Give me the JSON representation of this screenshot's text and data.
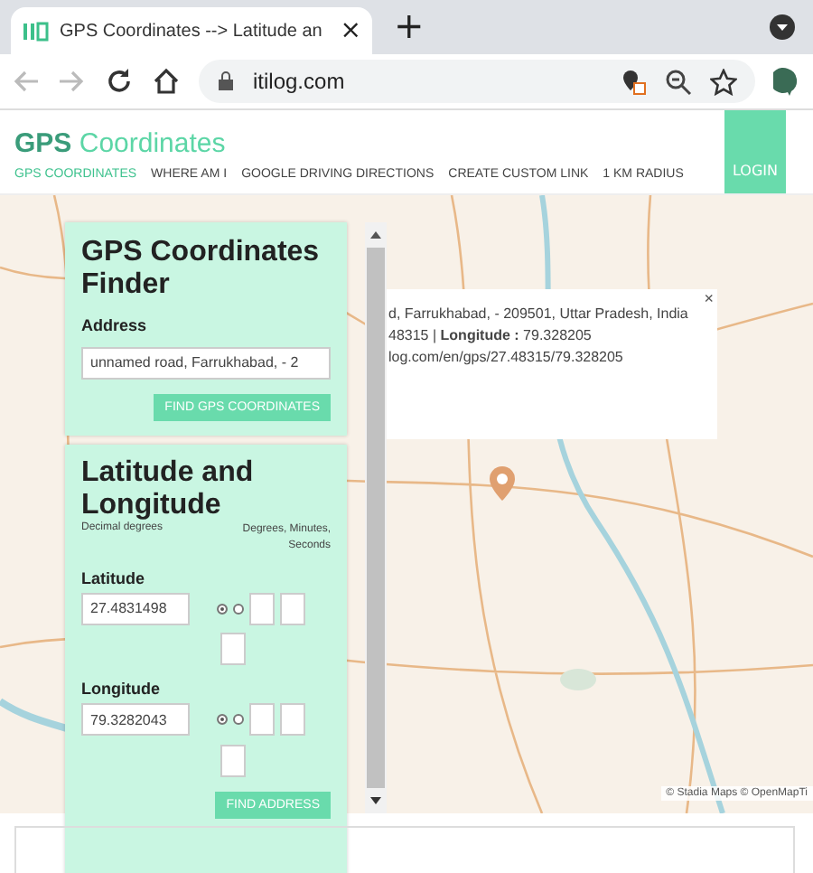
{
  "browser": {
    "tab": {
      "title": "GPS Coordinates --> Latitude an",
      "close": "×"
    },
    "new_tab": "+",
    "url": "itilog.com"
  },
  "site": {
    "logo": {
      "bold": "GPS",
      "light": "Coordinates"
    },
    "nav": [
      {
        "label": "GPS COORDINATES",
        "selected": true
      },
      {
        "label": "WHERE AM I",
        "selected": false
      },
      {
        "label": "GOOGLE DRIVING DIRECTIONS",
        "selected": false
      },
      {
        "label": "CREATE CUSTOM LINK",
        "selected": false
      },
      {
        "label": "1 KM RADIUS",
        "selected": false
      }
    ],
    "login": "LOGIN"
  },
  "map": {
    "popup": {
      "lines": [
        "d, Farrukhabad, - 209501, Uttar Pradesh, India",
        "48315 | **Longitude :** 79.328205",
        "log.com/en/gps/27.48315/79.328205"
      ],
      "close": "×"
    },
    "attribution": "© Stadia Maps © OpenMapTi"
  },
  "finder": {
    "title": "GPS Coordinates Finder",
    "address_label": "Address",
    "address_value": "unnamed road, Farrukhabad, - 2",
    "button": "FIND GPS COORDINATES"
  },
  "converter": {
    "title": "Latitude and Longitude",
    "decimal_header": "Decimal degrees",
    "dms_header": "Degrees, Minutes, Seconds",
    "fields": [
      {
        "label": "Latitude",
        "value": "27.4831498",
        "decimal_selected": true
      },
      {
        "label": "Longitude",
        "value": "79.3282043",
        "decimal_selected": true
      }
    ],
    "button": "FIND ADDRESS"
  }
}
